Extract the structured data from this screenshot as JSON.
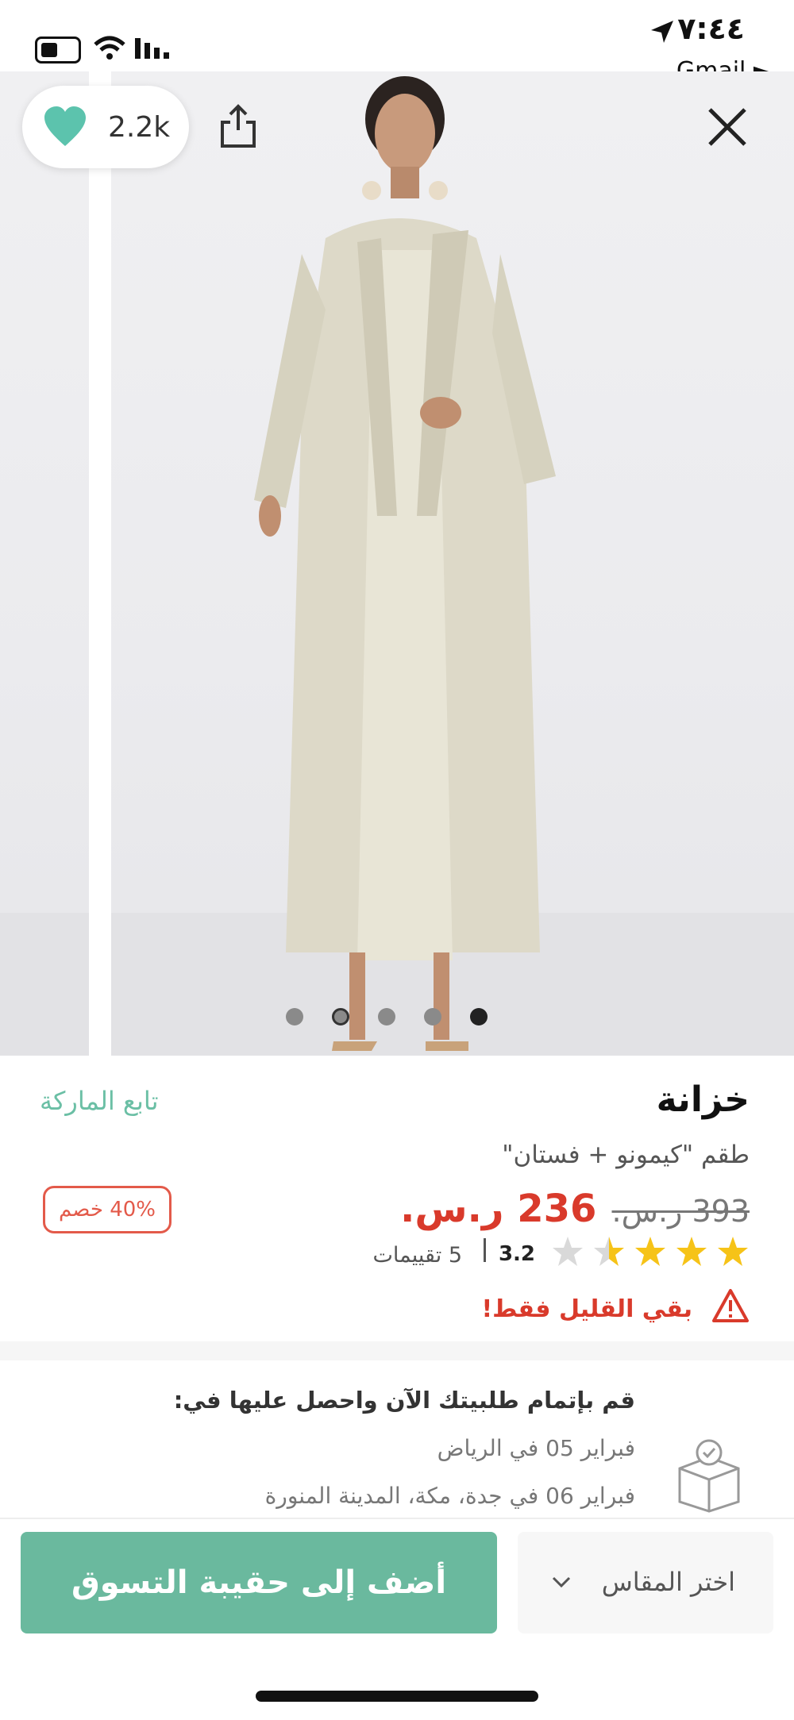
{
  "status_bar": {
    "time": "٧:٤٤",
    "back_app": "Gmail ►"
  },
  "hero": {
    "like_count": "2.2k",
    "image_description": "model wearing long cream satin kimono and dress",
    "page_dots": 5,
    "active_dot": 5
  },
  "product": {
    "brand": "خزانة",
    "follow_brand": "تابع الماركة",
    "name": "طقم \"كيمونو + فستان\"",
    "old_price": "393 ر.س.",
    "new_price": "236 ر.س.",
    "discount": "40% خصم",
    "rating_value": "3.2",
    "stars_out_of_5": 3.2,
    "reviews": "5 تقييمات",
    "low_stock": "بقي القليل فقط!"
  },
  "delivery": {
    "title": "قم بإتمام طلبيتك الآن واحصل عليها في:",
    "line1": "فبراير 05 في الرياض",
    "line2": "فبراير 06 في جدة، مكة، المدينة المنورة"
  },
  "actions": {
    "add_to_bag": "أضف إلى حقيبة التسوق",
    "select_size": "اختر المقاس"
  },
  "colors": {
    "accent": "#6ab99e",
    "price_red": "#d93a2b",
    "heart": "#5cc3ad"
  }
}
